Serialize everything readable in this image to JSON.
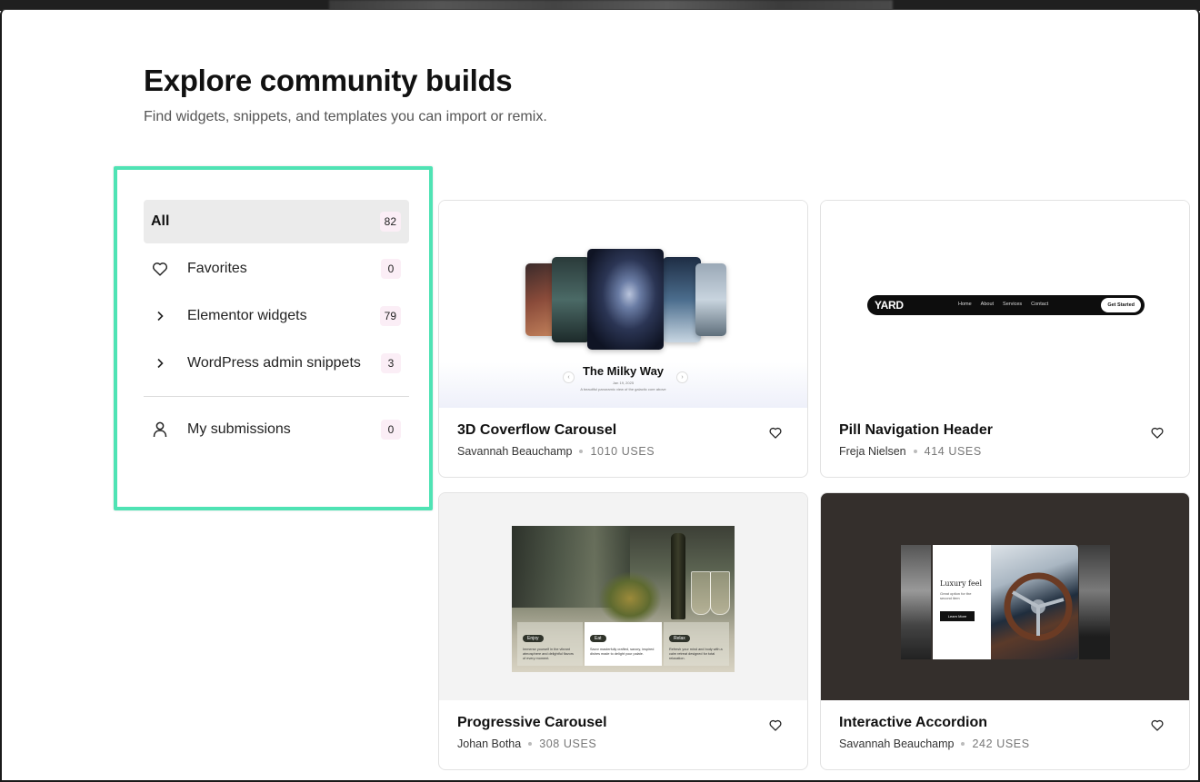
{
  "header": {
    "title": "Explore community builds",
    "subtitle": "Find widgets, snippets, and templates you can import or remix."
  },
  "sidebar": {
    "items": [
      {
        "label": "All",
        "count": "82",
        "icon": "none",
        "active": true
      },
      {
        "label": "Favorites",
        "count": "0",
        "icon": "heart-icon"
      },
      {
        "label": "Elementor widgets",
        "count": "79",
        "icon": "chevron-right-icon"
      },
      {
        "label": "WordPress admin snippets",
        "count": "3",
        "icon": "chevron-right-icon"
      },
      {
        "label": "My submissions",
        "count": "0",
        "icon": "user-icon"
      }
    ],
    "highlight_color": "#4fe3b4"
  },
  "cards": [
    {
      "title": "3D Coverflow Carousel",
      "author": "Savannah Beauchamp",
      "uses": "1010 USES",
      "preview": {
        "heading": "The Milky Way",
        "date": "Jan 19, 2025",
        "caption": "A beautiful panoramic view of the galactic core above"
      }
    },
    {
      "title": "Pill Navigation Header",
      "author": "Freja Nielsen",
      "uses": "414 USES",
      "preview": {
        "brand": "YARD",
        "links": [
          "Home",
          "About",
          "Services",
          "Contact"
        ],
        "cta": "Get Started"
      }
    },
    {
      "title": "Progressive Carousel",
      "author": "Johan Botha",
      "uses": "308 USES",
      "preview": {
        "panels": [
          {
            "tag": "Enjoy",
            "text": "Immerse yourself in the vibrant atmosphere and delightful flavors of every moment."
          },
          {
            "tag": "Eat",
            "text": "Savor masterfully crafted, savory, inspired dishes made to delight your palate."
          },
          {
            "tag": "Relax",
            "text": "Refresh your mind and body with a calm retreat designed for total relaxation."
          }
        ]
      }
    },
    {
      "title": "Interactive Accordion",
      "author": "Savannah Beauchamp",
      "uses": "242 USES",
      "preview": {
        "heading": "Luxury feel",
        "text": "Great option for the second item",
        "button": "Learn More"
      }
    }
  ],
  "colors": {
    "accent": "#4fe3b4",
    "count_badge_bg": "#fbeef6",
    "active_item_bg": "#ebebeb",
    "accordion_bg": "#342f2c"
  }
}
